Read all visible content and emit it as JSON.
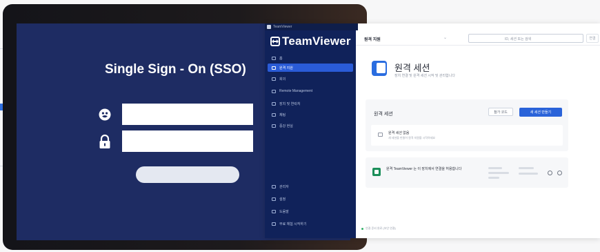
{
  "sso": {
    "title": "Single Sign - On (SSO)",
    "username_value": "",
    "password_value": "",
    "login_label": ""
  },
  "teamviewer": {
    "window_title": "TeamViewer",
    "brand": "TeamViewer",
    "nav": [
      {
        "label": "홈",
        "active": false
      },
      {
        "label": "원격 지원",
        "active": true
      },
      {
        "label": "회의",
        "active": false
      },
      {
        "label": "Remote Management",
        "active": false
      },
      {
        "label": "장치 및 연락처",
        "active": false
      },
      {
        "label": "채팅",
        "active": false
      },
      {
        "label": "증강 현실",
        "active": false
      }
    ],
    "nav_bottom": [
      {
        "label": "관리자"
      },
      {
        "label": "설정"
      },
      {
        "label": "도움말"
      },
      {
        "label": "무료 체험 시작하기"
      }
    ],
    "topbar": {
      "label": "원격 지원",
      "search_placeholder": "ID, 세션 또는 검색",
      "search_side": "연결"
    },
    "header": {
      "title": "원격 세션",
      "subtitle": "장치 연결 및 원격 세션 시작 및 관리합니다"
    },
    "sessions": {
      "title": "원격 세션",
      "ghost_button": "참가 코드",
      "primary_button": "새 세션 만들기",
      "empty_title": "원격 세션 없음",
      "empty_sub": "새 세션을 만들어 원격 지원을 시작하세요"
    },
    "device": {
      "text": "원격 TeamViewer 는 이 장치에서 연결을 허용합니다"
    },
    "status": "연결 준비 완료 (보안 연결)"
  }
}
